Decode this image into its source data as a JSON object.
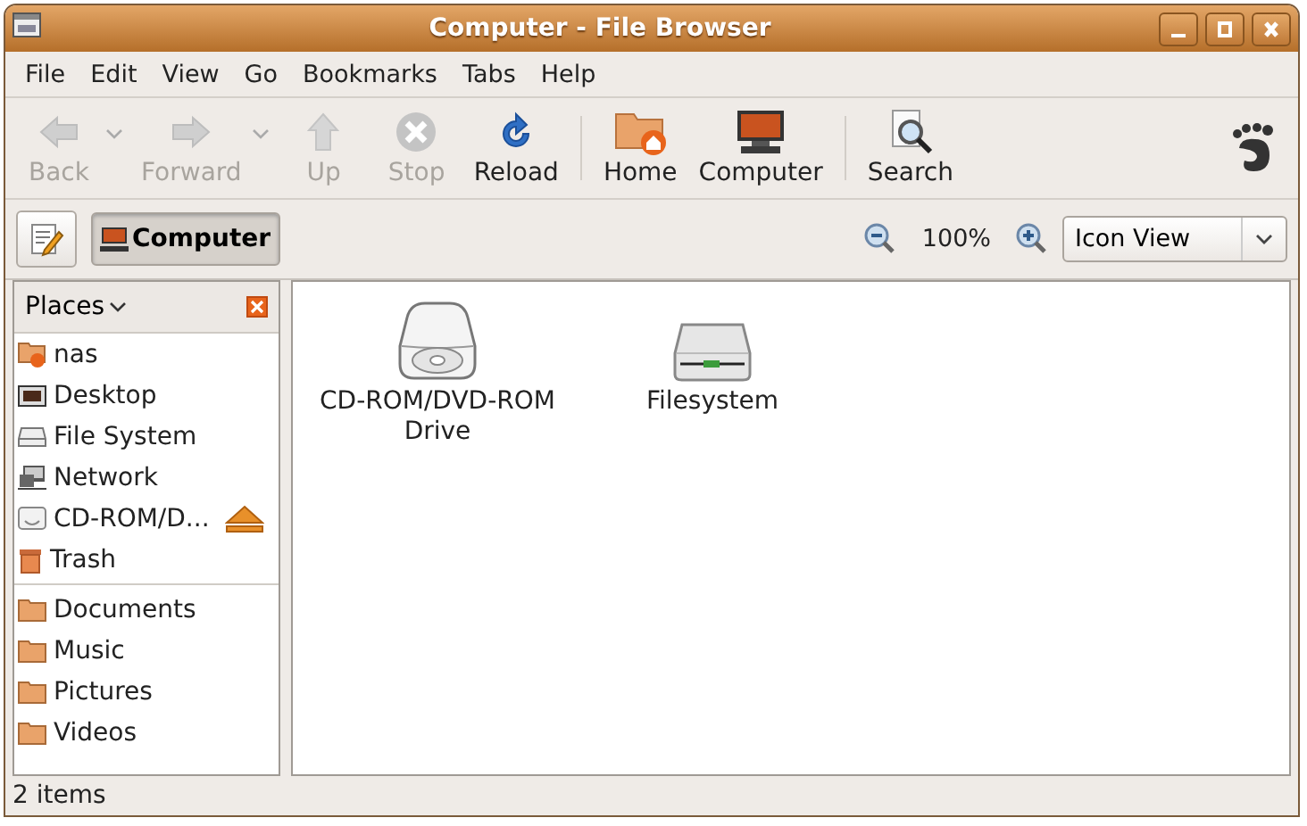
{
  "window": {
    "title": "Computer - File Browser"
  },
  "menu": [
    "File",
    "Edit",
    "View",
    "Go",
    "Bookmarks",
    "Tabs",
    "Help"
  ],
  "toolbar": {
    "groups": [
      [
        {
          "label": "Back",
          "disabled": true,
          "dropdown": true
        },
        {
          "label": "Forward",
          "disabled": true,
          "dropdown": true
        },
        {
          "label": "Up",
          "disabled": true,
          "dropdown": false
        },
        {
          "label": "Stop",
          "disabled": true,
          "dropdown": false
        },
        {
          "label": "Reload",
          "disabled": false,
          "dropdown": false
        }
      ],
      [
        {
          "label": "Home",
          "disabled": false,
          "dropdown": false
        },
        {
          "label": "Computer",
          "disabled": false,
          "dropdown": false
        }
      ],
      [
        {
          "label": "Search",
          "disabled": false,
          "dropdown": false
        }
      ]
    ]
  },
  "location": {
    "button": {
      "label": "Computer",
      "selected": true
    },
    "zoom": "100%",
    "view": "Icon View"
  },
  "sidebar": {
    "title": "Places",
    "sections": [
      [
        {
          "label": "nas",
          "eject": false
        },
        {
          "label": "Desktop",
          "eject": false
        },
        {
          "label": "File System",
          "eject": false
        },
        {
          "label": "Network",
          "eject": false
        },
        {
          "label": "CD-ROM/D...",
          "eject": true
        },
        {
          "label": "Trash",
          "eject": false
        }
      ],
      [
        {
          "label": "Documents",
          "eject": false
        },
        {
          "label": "Music",
          "eject": false
        },
        {
          "label": "Pictures",
          "eject": false
        },
        {
          "label": "Videos",
          "eject": false
        }
      ]
    ]
  },
  "files": [
    {
      "label": "CD-ROM/DVD-ROM Drive",
      "kind": "optical"
    },
    {
      "label": "Filesystem",
      "kind": "disk"
    }
  ],
  "status_bar": "2 items"
}
